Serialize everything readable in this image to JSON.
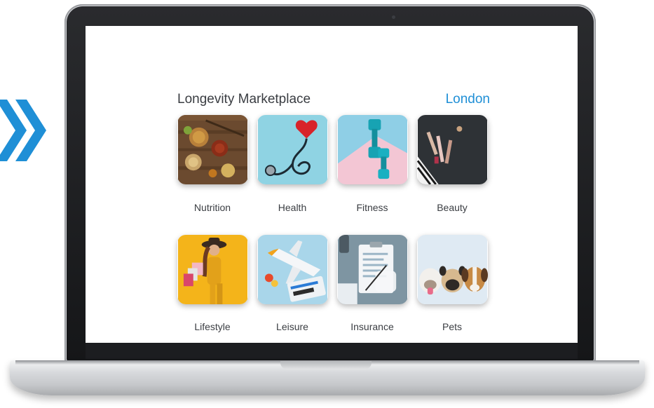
{
  "header": {
    "title": "Longevity Marketplace",
    "location": "London"
  },
  "categories": [
    {
      "label": "Nutrition",
      "icon": "nutrition-image"
    },
    {
      "label": "Health",
      "icon": "stethoscope-heart-image"
    },
    {
      "label": "Fitness",
      "icon": "dumbbells-image"
    },
    {
      "label": "Beauty",
      "icon": "makeup-brushes-image"
    },
    {
      "label": "Lifestyle",
      "icon": "shopping-woman-image"
    },
    {
      "label": "Leisure",
      "icon": "plane-tickets-image"
    },
    {
      "label": "Insurance",
      "icon": "clipboard-form-image"
    },
    {
      "label": "Pets",
      "icon": "dogs-image"
    }
  ],
  "colors": {
    "accent": "#1f8fd6",
    "chevron": "#1f8fd6",
    "text": "#3a3d42"
  }
}
